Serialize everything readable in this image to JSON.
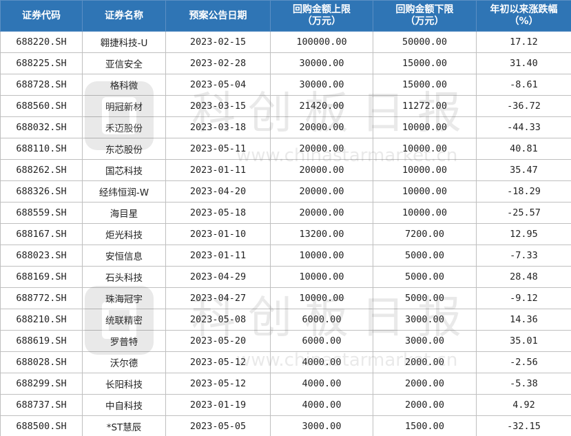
{
  "table": {
    "headers": [
      "证券代码",
      "证券名称",
      "预案公告日期",
      "回购金额上限\n（万元）",
      "回购金额下限\n（万元）",
      "年初以来涨跌幅\n（%）"
    ],
    "rows": [
      [
        "688220.SH",
        "翱捷科技-U",
        "2023-02-15",
        "100000.00",
        "50000.00",
        "17.12"
      ],
      [
        "688225.SH",
        "亚信安全",
        "2023-02-28",
        "30000.00",
        "15000.00",
        "31.40"
      ],
      [
        "688728.SH",
        "格科微",
        "2023-05-04",
        "30000.00",
        "15000.00",
        "-8.61"
      ],
      [
        "688560.SH",
        "明冠新材",
        "2023-03-15",
        "21420.00",
        "11272.00",
        "-36.72"
      ],
      [
        "688032.SH",
        "禾迈股份",
        "2023-03-18",
        "20000.00",
        "10000.00",
        "-44.33"
      ],
      [
        "688110.SH",
        "东芯股份",
        "2023-05-11",
        "20000.00",
        "10000.00",
        "40.81"
      ],
      [
        "688262.SH",
        "国芯科技",
        "2023-01-11",
        "20000.00",
        "10000.00",
        "35.47"
      ],
      [
        "688326.SH",
        "经纬恒润-W",
        "2023-04-20",
        "20000.00",
        "10000.00",
        "-18.29"
      ],
      [
        "688559.SH",
        "海目星",
        "2023-05-18",
        "20000.00",
        "10000.00",
        "-25.57"
      ],
      [
        "688167.SH",
        "炬光科技",
        "2023-01-10",
        "13200.00",
        "7200.00",
        "12.95"
      ],
      [
        "688023.SH",
        "安恒信息",
        "2023-01-11",
        "10000.00",
        "5000.00",
        "-7.33"
      ],
      [
        "688169.SH",
        "石头科技",
        "2023-04-29",
        "10000.00",
        "5000.00",
        "28.48"
      ],
      [
        "688772.SH",
        "珠海冠宇",
        "2023-04-27",
        "10000.00",
        "5000.00",
        "-9.12"
      ],
      [
        "688210.SH",
        "统联精密",
        "2023-05-08",
        "6000.00",
        "3000.00",
        "14.36"
      ],
      [
        "688619.SH",
        "罗普特",
        "2023-05-20",
        "6000.00",
        "3000.00",
        "35.01"
      ],
      [
        "688028.SH",
        "沃尔德",
        "2023-05-12",
        "4000.00",
        "2000.00",
        "-2.56"
      ],
      [
        "688299.SH",
        "长阳科技",
        "2023-05-12",
        "4000.00",
        "2000.00",
        "-5.38"
      ],
      [
        "688737.SH",
        "中自科技",
        "2023-01-19",
        "4000.00",
        "2000.00",
        "4.92"
      ],
      [
        "688500.SH",
        "*ST慧辰",
        "2023-05-05",
        "3000.00",
        "1500.00",
        "-32.15"
      ]
    ]
  },
  "watermark": {
    "title": "科创板日报",
    "url": "www.chinastarmarket.cn"
  },
  "colors": {
    "header_bg": "#2f75b5",
    "header_text": "#ffffff",
    "grid": "#bfbfbf"
  }
}
